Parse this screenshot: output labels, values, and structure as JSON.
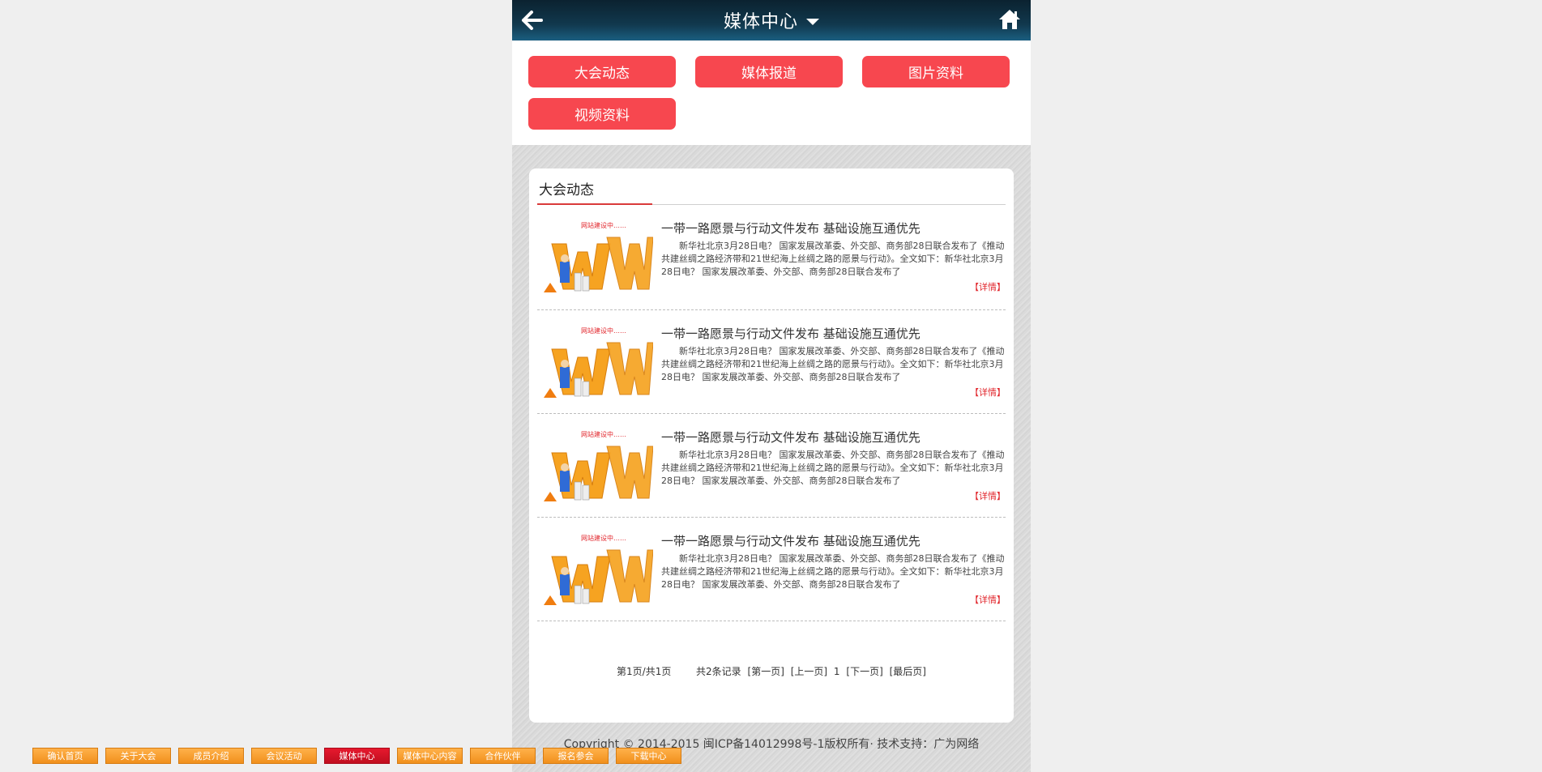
{
  "header": {
    "title": "媒体中心"
  },
  "nav": {
    "items": [
      "大会动态",
      "媒体报道",
      "图片资料",
      "视频资料"
    ]
  },
  "section": {
    "title": "大会动态"
  },
  "news": [
    {
      "title": "一带一路愿景与行动文件发布  基础设施互通优先",
      "desc": "新华社北京3月28日电？ 国家发展改革委、外交部、商务部28日联合发布了《推动共建丝绸之路经济带和21世纪海上丝绸之路的愿景与行动》。全文如下：新华社北京3月28日电？ 国家发展改革委、外交部、商务部28日联合发布了",
      "more": "【详情】",
      "thumb_caption": "网站建设中……"
    },
    {
      "title": "一带一路愿景与行动文件发布  基础设施互通优先",
      "desc": "新华社北京3月28日电？ 国家发展改革委、外交部、商务部28日联合发布了《推动共建丝绸之路经济带和21世纪海上丝绸之路的愿景与行动》。全文如下：新华社北京3月28日电？ 国家发展改革委、外交部、商务部28日联合发布了",
      "more": "【详情】",
      "thumb_caption": "网站建设中……"
    },
    {
      "title": "一带一路愿景与行动文件发布  基础设施互通优先",
      "desc": "新华社北京3月28日电？ 国家发展改革委、外交部、商务部28日联合发布了《推动共建丝绸之路经济带和21世纪海上丝绸之路的愿景与行动》。全文如下：新华社北京3月28日电？ 国家发展改革委、外交部、商务部28日联合发布了",
      "more": "【详情】",
      "thumb_caption": "网站建设中……"
    },
    {
      "title": "一带一路愿景与行动文件发布  基础设施互通优先",
      "desc": "新华社北京3月28日电？ 国家发展改革委、外交部、商务部28日联合发布了《推动共建丝绸之路经济带和21世纪海上丝绸之路的愿景与行动》。全文如下：新华社北京3月28日电？ 国家发展改革委、外交部、商务部28日联合发布了",
      "more": "【详情】",
      "thumb_caption": "网站建设中……"
    }
  ],
  "pager": {
    "page_info": "第1页/共1页",
    "total": "共2条记录",
    "first": "[第一页]",
    "prev": "[上一页]",
    "current": "1",
    "next": "[下一页]",
    "last": "[最后页]"
  },
  "copyright": "Copyright © 2014-2015 闽ICP备14012998号-1版权所有·    技术支持：广为网络",
  "footer": {
    "items": [
      "确认首页",
      "关于大会",
      "成员介绍",
      "会议活动",
      "媒体中心",
      "媒体中心内容",
      "合作伙伴",
      "报名参会",
      "下载中心"
    ],
    "active_index": 4
  },
  "colors": {
    "accent": "#f7474f",
    "header": "#11384d",
    "footer_button": "#f1901c",
    "footer_active": "#c10e1f"
  }
}
